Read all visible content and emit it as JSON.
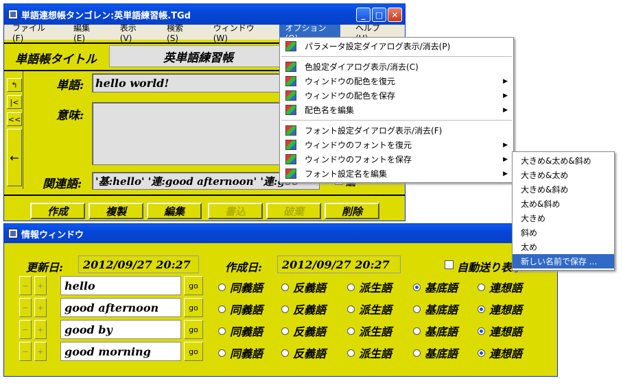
{
  "main": {
    "title": "単語連想帳タンゴレン:英単語練習帳.TGd",
    "menu": [
      "ファイル(F)",
      "編集(E)",
      "表示(V)",
      "検索(S)",
      "ウィンドウ(W)",
      "オプション(O)",
      "ヘルプ(H)"
    ],
    "book_title_label": "単語帳タイトル",
    "book_title": "英単語練習帳",
    "word_label": "単語:",
    "word": "hello world!",
    "meaning_label": "意味:",
    "related_label": "関連語:",
    "related": "'基:hello' '連:good afternoon' '連:goo",
    "checkbox_label": "編",
    "nav": [
      "↰",
      "|<",
      "<<",
      "←"
    ],
    "buttons": {
      "create": "作成",
      "copy": "複製",
      "edit": "編集",
      "write": "書込",
      "discard": "破棄",
      "delete": "削除"
    }
  },
  "option_menu": [
    {
      "label": "パラメータ設定ダイアログ表示/消去(P)",
      "sub": false
    },
    {
      "sep": true
    },
    {
      "label": "色設定ダイアログ表示/消去(C)",
      "sub": false
    },
    {
      "label": "ウィンドウの配色を復元",
      "sub": true
    },
    {
      "label": "ウィンドウの配色を保存",
      "sub": true
    },
    {
      "label": "配色名を編集",
      "sub": true
    },
    {
      "sep": true
    },
    {
      "label": "フォント設定ダイアログ表示/消去(F)",
      "sub": false
    },
    {
      "label": "ウィンドウのフォントを復元",
      "sub": true
    },
    {
      "label": "ウィンドウのフォントを保存",
      "sub": true
    },
    {
      "label": "フォント設定名を編集",
      "sub": true
    }
  ],
  "submenu": [
    "大きめ&太め&斜め",
    "大きめ&太め",
    "大きめ&斜め",
    "太め&斜め",
    "大きめ",
    "斜め",
    "太め",
    "新しい名前で保存 ..."
  ],
  "info": {
    "title": "情報ウィンドウ",
    "updated_label": "更新日:",
    "updated": "2012/09/27 20:27",
    "created_label": "作成日:",
    "created": "2012/09/27 20:27",
    "auto_label": "自動送り表示",
    "go": "go",
    "relation_types": [
      "同義語",
      "反義語",
      "派生語",
      "基底語",
      "連想語"
    ],
    "rows": [
      {
        "word": "hello",
        "selected": 3
      },
      {
        "word": "good afternoon",
        "selected": 4
      },
      {
        "word": "good by",
        "selected": 4
      },
      {
        "word": "good morning",
        "selected": 4
      }
    ]
  }
}
